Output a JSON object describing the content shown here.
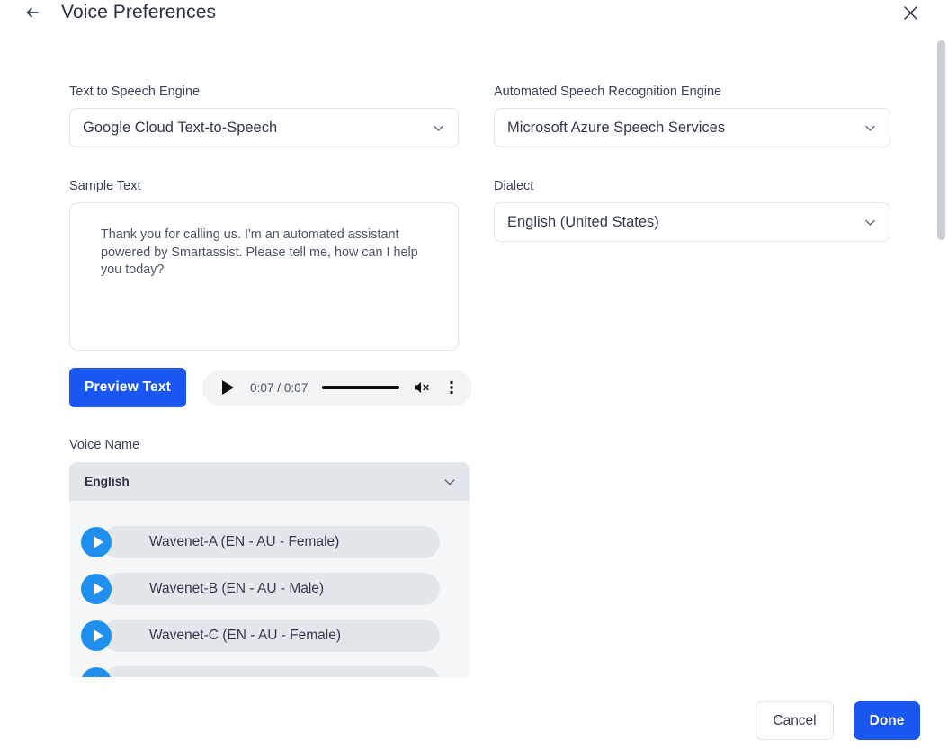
{
  "header": {
    "title": "Voice Preferences",
    "back_icon": "arrow-left-icon",
    "close_icon": "close-icon"
  },
  "form": {
    "tts": {
      "label": "Text to Speech Engine",
      "value": "Google Cloud Text-to-Speech",
      "chevron_icon": "chevron-down-icon"
    },
    "asr": {
      "label": "Automated Speech Recognition Engine",
      "value": "Microsoft Azure Speech Services",
      "chevron_icon": "chevron-down-icon"
    },
    "dialect": {
      "label": "Dialect",
      "value": "English (United States)",
      "chevron_icon": "chevron-down-icon"
    },
    "sample_text": {
      "label": "Sample Text",
      "value": "Thank you for calling us. I'm an automated assistant powered by Smartassist. Please tell me, how can I help you today?"
    }
  },
  "preview": {
    "button_label": "Preview Text",
    "player": {
      "play_icon": "play-icon",
      "time": "0:07 / 0:07",
      "current_time": "0:07",
      "duration": "0:07",
      "progress_percent": 100,
      "mute_icon": "volume-muted-icon",
      "muted": true,
      "menu_icon": "more-vertical-icon"
    }
  },
  "voice_name": {
    "label": "Voice Name",
    "group": {
      "label": "English",
      "chevron_icon": "chevron-down-icon",
      "expanded": true
    },
    "items": [
      {
        "label": "Wavenet-A (EN - AU - Female)",
        "play_icon": "play-circle-icon"
      },
      {
        "label": "Wavenet-B (EN - AU - Male)",
        "play_icon": "play-circle-icon"
      },
      {
        "label": "Wavenet-C (EN - AU - Female)",
        "play_icon": "play-circle-icon"
      },
      {
        "label": "",
        "play_icon": "play-circle-icon"
      }
    ]
  },
  "footer": {
    "cancel_label": "Cancel",
    "done_label": "Done"
  },
  "colors": {
    "accent_blue": "#1a56f0",
    "play_blue": "#1f90ef",
    "panel_bg": "#f6f7f9",
    "group_header_bg": "#e3e7ec",
    "item_bg": "#e3e7eb",
    "border": "#dfe3eb",
    "text": "#32394d",
    "player_bg": "#f1f3f4"
  }
}
